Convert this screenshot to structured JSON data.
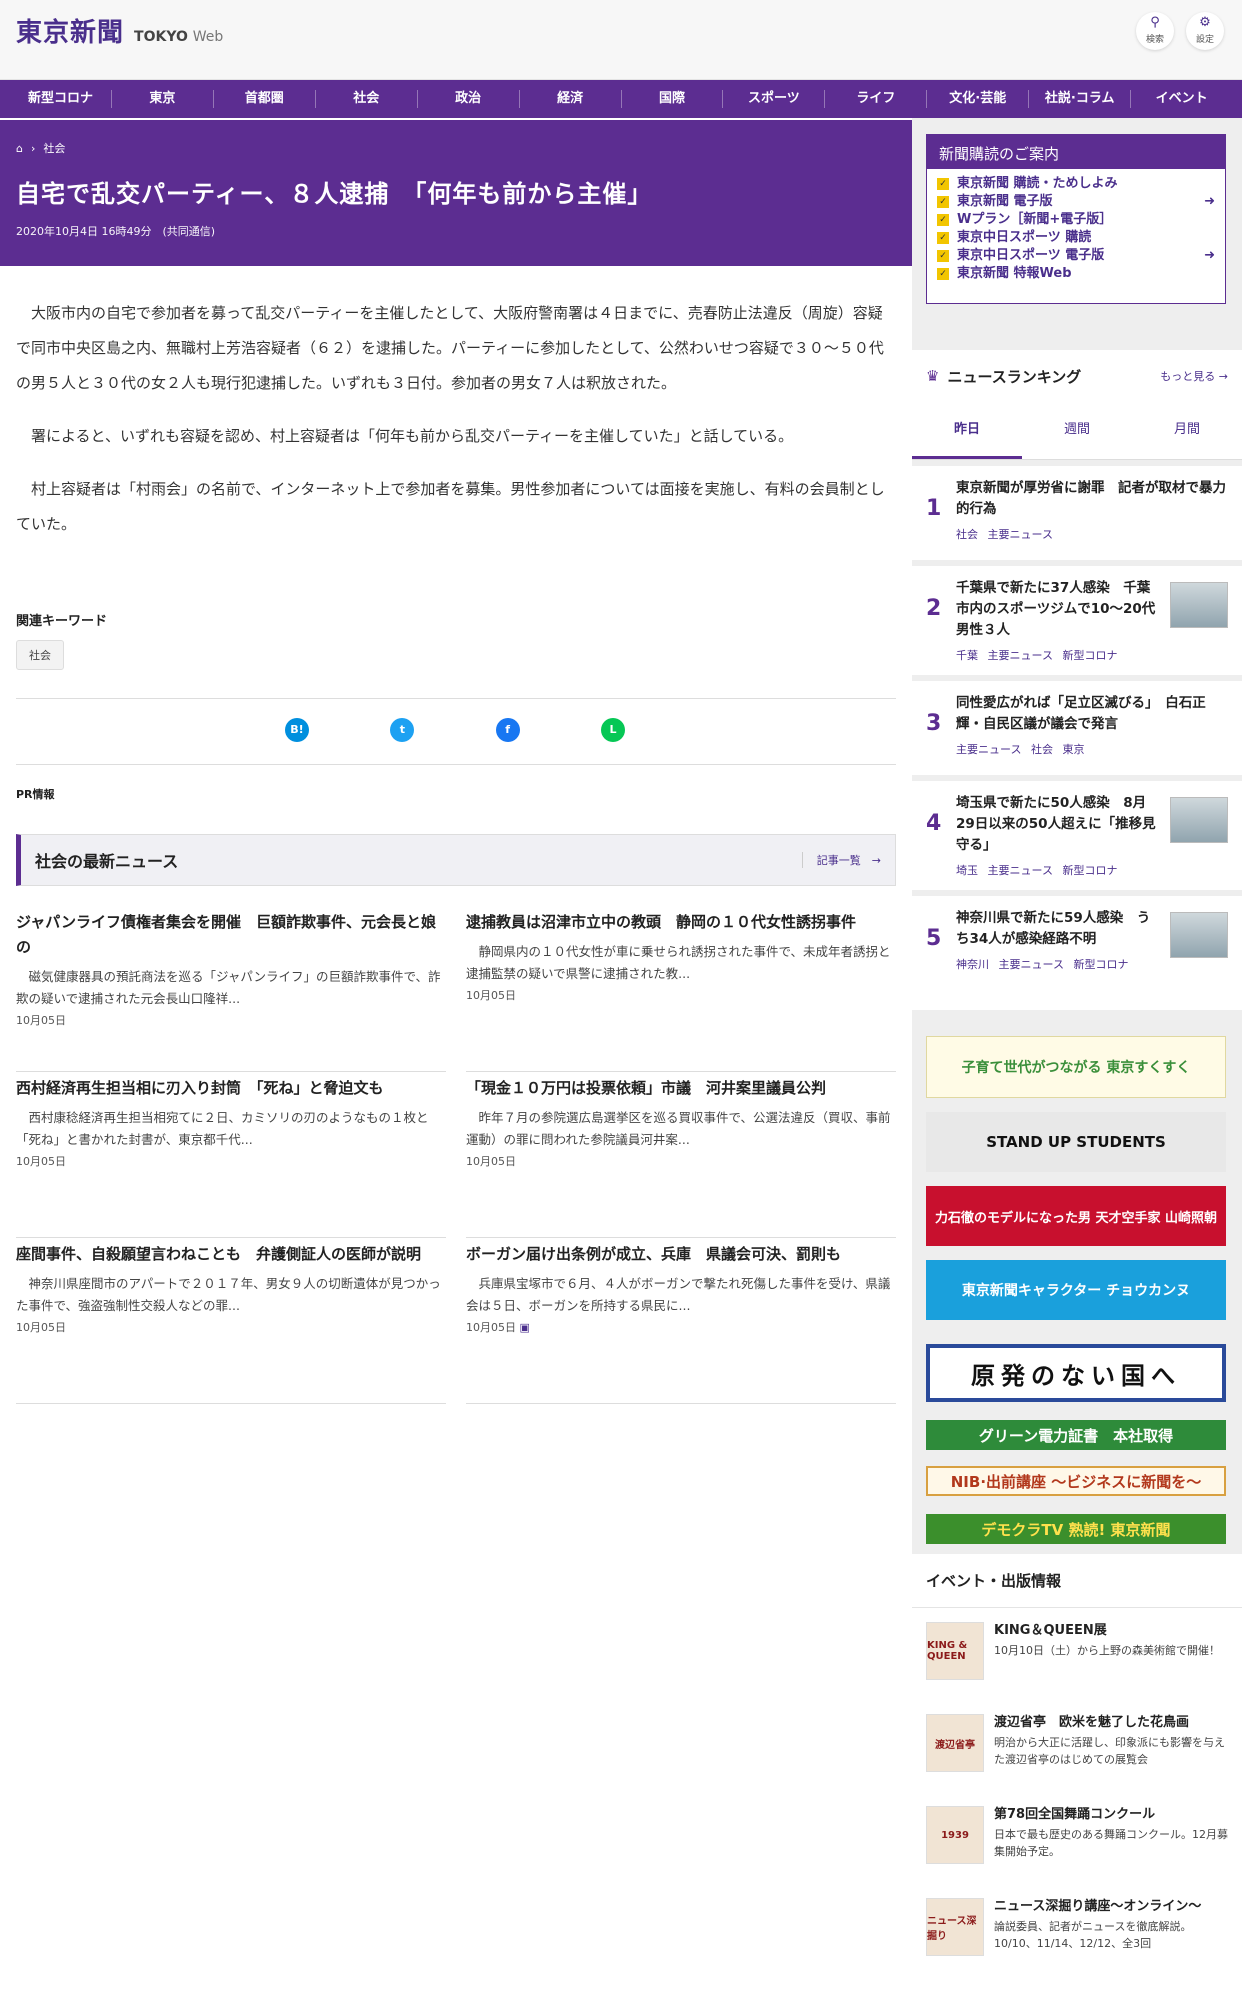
{
  "header": {
    "logo_jp": "東京新聞",
    "logo_en_bold": "TOKYO",
    "logo_en_light": "Web",
    "search_label": "検索",
    "settings_label": "設定"
  },
  "nav": [
    "新型コロナ",
    "東京",
    "首都圏",
    "社会",
    "政治",
    "経済",
    "国際",
    "スポーツ",
    "ライフ",
    "文化·芸能",
    "社説·コラム",
    "イベント"
  ],
  "article": {
    "breadcrumb_section": "社会",
    "headline": "自宅で乱交パーティー、８人逮捕　「何年も前から主催」",
    "dateline": "2020年10月4日 16時49分　(共同通信)",
    "paragraphs": [
      "大阪市内の自宅で参加者を募って乱交パーティーを主催したとして、大阪府警南署は４日までに、売春防止法違反（周旋）容疑で同市中央区島之内、無職村上芳浩容疑者（６２）を逮捕した。パーティーに参加したとして、公然わいせつ容疑で３０～５０代の男５人と３０代の女２人も現行犯逮捕した。いずれも３日付。参加者の男女７人は釈放された。",
      "署によると、いずれも容疑を認め、村上容疑者は「何年も前から乱交パーティーを主催していた」と話している。",
      "村上容疑者は「村雨会」の名前で、インターネット上で参加者を募集。男性参加者については面接を実施し、有料の会員制としていた。"
    ],
    "keywords_title": "関連キーワード",
    "keyword": "社会",
    "share": [
      {
        "name": "hatena",
        "glyph": "B!",
        "color": "#008fde"
      },
      {
        "name": "twitter",
        "glyph": "t",
        "color": "#1da1f2"
      },
      {
        "name": "facebook",
        "glyph": "f",
        "color": "#1877f2"
      },
      {
        "name": "line",
        "glyph": "L",
        "color": "#06c755"
      }
    ],
    "pr_label": "PR情報"
  },
  "latest": {
    "title": "社会の最新ニュース",
    "more_label": "記事一覧　→",
    "items": [
      {
        "title": "ジャパンライフ債権者集会を開催　巨額詐欺事件、元会長と娘の",
        "summary": "磁気健康器具の預託商法を巡る「ジャパンライフ」の巨額詐欺事件で、詐欺の疑いで逮捕された元会長山口隆祥...",
        "date": "10月05日"
      },
      {
        "title": "逮捕教員は沼津市立中の教頭　静岡の１０代女性誘拐事件",
        "summary": "静岡県内の１０代女性が車に乗せられ誘拐された事件で、未成年者誘拐と逮捕監禁の疑いで県警に逮捕された教...",
        "date": "10月05日"
      },
      {
        "title": "西村経済再生担当相に刃入り封筒　「死ね」と脅迫文も",
        "summary": "西村康稔経済再生担当相宛てに２日、カミソリの刃のようなもの１枚と「死ね」と書かれた封書が、東京都千代...",
        "date": "10月05日"
      },
      {
        "title": "「現金１０万円は投票依頼」市議　河井案里議員公判",
        "summary": "昨年７月の参院選広島選挙区を巡る買収事件で、公選法違反（買収、事前運動）の罪に問われた参院議員河井案...",
        "date": "10月05日"
      },
      {
        "title": "座間事件、自殺願望言わねことも　弁護側証人の医師が説明",
        "summary": "神奈川県座間市のアパートで２０１７年、男女９人の切断遺体が見つかった事件で、強盗強制性交殺人などの罪...",
        "date": "10月05日"
      },
      {
        "title": "ボーガン届け出条例が成立、兵庫　県議会可決、罰則も",
        "summary": "兵庫県宝塚市で６月、４人がボーガンで撃たれ死傷した事件を受け、県議会は５日、ボーガンを所持する県民に...",
        "date": "10月05日"
      }
    ]
  },
  "subscribe": {
    "title": "新聞購読のご案内",
    "items": [
      "東京新聞 購読・ためしよみ",
      "東京新聞 電子版",
      "Wプラン［新聞+電子版］",
      "東京中日スポーツ 購読",
      "東京中日スポーツ 電子版",
      "東京新聞 特報Web"
    ]
  },
  "ranking": {
    "title": "ニュースランキング",
    "more_label": "もっと見る →",
    "tabs": [
      "昨日",
      "週間",
      "月間"
    ],
    "items": [
      {
        "rank": "1",
        "title": "東京新聞が厚労省に謝罪　記者が取材で暴力的行為",
        "tags": "社会 主要ニュース",
        "thumb": false
      },
      {
        "rank": "2",
        "title": "千葉県で新たに37人感染　千葉市内のスポーツジムで10～20代男性３人",
        "tags": "千葉 主要ニュース 新型コロナ",
        "thumb": true
      },
      {
        "rank": "3",
        "title": "同性愛広がれば「足立区滅びる」　白石正輝・自民区議が議会で発言",
        "tags": "主要ニュース 社会 東京",
        "thumb": false
      },
      {
        "rank": "4",
        "title": "埼玉県で新たに50人感染　8月29日以来の50人超えに「推移見守る」",
        "tags": "埼玉 主要ニュース 新型コロナ",
        "thumb": true
      },
      {
        "rank": "5",
        "title": "神奈川県で新たに59人感染　うち34人が感染経路不明",
        "tags": "神奈川 主要ニュース 新型コロナ",
        "thumb": true
      }
    ]
  },
  "banners": [
    {
      "text": "子育て世代がつながる 東京すくすく",
      "bg": "#fffbe6",
      "fg": "#3a8f3a"
    },
    {
      "text": "STAND UP STUDENTS",
      "bg": "#e8e8e8",
      "fg": "#111"
    },
    {
      "text": "力石徹のモデルになった男 天才空手家 山崎照朝",
      "bg": "#c8102e",
      "fg": "#ffffff"
    },
    {
      "text": "東京新聞キャラクター チョウカンヌ",
      "bg": "#1aa0dc",
      "fg": "#ffffff"
    },
    {
      "text": "原発のない国へ",
      "bg": "#2a4a9a",
      "fg": "#111"
    },
    {
      "text": "グリーン電力証書　本社取得",
      "bg": "#2e8b3a",
      "fg": "#ffffff"
    },
    {
      "text": "NIB·出前講座 ～ビジネスに新聞を～",
      "bg": "#fff8e8",
      "fg": "#b2381c"
    },
    {
      "text": "デモクラTV 熟読! 東京新聞",
      "bg": "#3b8f2c",
      "fg": "#ffe14d"
    }
  ],
  "events": {
    "title": "イベント・出版情報",
    "items": [
      {
        "img": "KING & QUEEN",
        "title": "KING＆QUEEN展",
        "desc": "10月10日（土）から上野の森美術館で開催！"
      },
      {
        "img": "渡辺省亭",
        "title": "渡辺省亭　欧米を魅了した花鳥画",
        "desc": "明治から大正に活躍し、印象派にも影響を与えた渡辺省亭のはじめての展覧会"
      },
      {
        "img": "1939",
        "title": "第78回全国舞踊コンクール",
        "desc": "日本で最も歴史のある舞踊コンクール。12月募集開始予定。"
      },
      {
        "img": "ニュース深掘り",
        "title": "ニュース深掘り講座～オンライン～",
        "desc": "論説委員、記者がニュースを徹底解説。10/10、11/14、12/12、全3回"
      }
    ]
  }
}
